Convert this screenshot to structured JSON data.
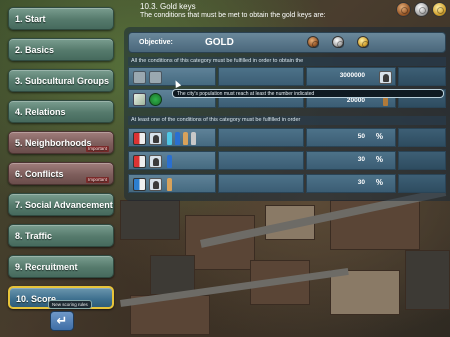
{
  "menu": [
    {
      "label": "1.  Start",
      "important": ""
    },
    {
      "label": "2.  Basics",
      "important": ""
    },
    {
      "label": "3.  Subcultural Groups",
      "important": ""
    },
    {
      "label": "4.  Relations",
      "important": ""
    },
    {
      "label": "5.  Neighborhoods",
      "important": "Important"
    },
    {
      "label": "6.  Conflicts",
      "important": "Important"
    },
    {
      "label": "7.  Social Advancement",
      "important": ""
    },
    {
      "label": "8.  Traffic",
      "important": ""
    },
    {
      "label": "9.  Recruitment",
      "important": ""
    },
    {
      "label": "10. Score",
      "important": ""
    }
  ],
  "score_tooltip": "New scoring rules",
  "back_icon": "back-arrow-icon",
  "header": {
    "section": "10.3. Gold keys",
    "description": "The conditions that must be met to obtain the gold keys are:"
  },
  "top_medals": [
    "bronze",
    "silver",
    "gold"
  ],
  "objective": {
    "label": "Objective:",
    "value": "GOLD"
  },
  "section_all": "All the conditions of this category must be fulfilled in order to obtain the",
  "section_one": "At least one of the conditions of this category must be fulfilled in order",
  "rows_all": [
    {
      "value": "3000000",
      "unit_icon": "money-icon"
    },
    {
      "value": "20000",
      "unit_icon": "person-icon"
    }
  ],
  "tooltip": "The city's population must reach at least the number indicated",
  "rows_one": [
    {
      "value": "50",
      "unit": "%"
    },
    {
      "value": "30",
      "unit": "%"
    },
    {
      "value": "30",
      "unit": "%"
    }
  ]
}
